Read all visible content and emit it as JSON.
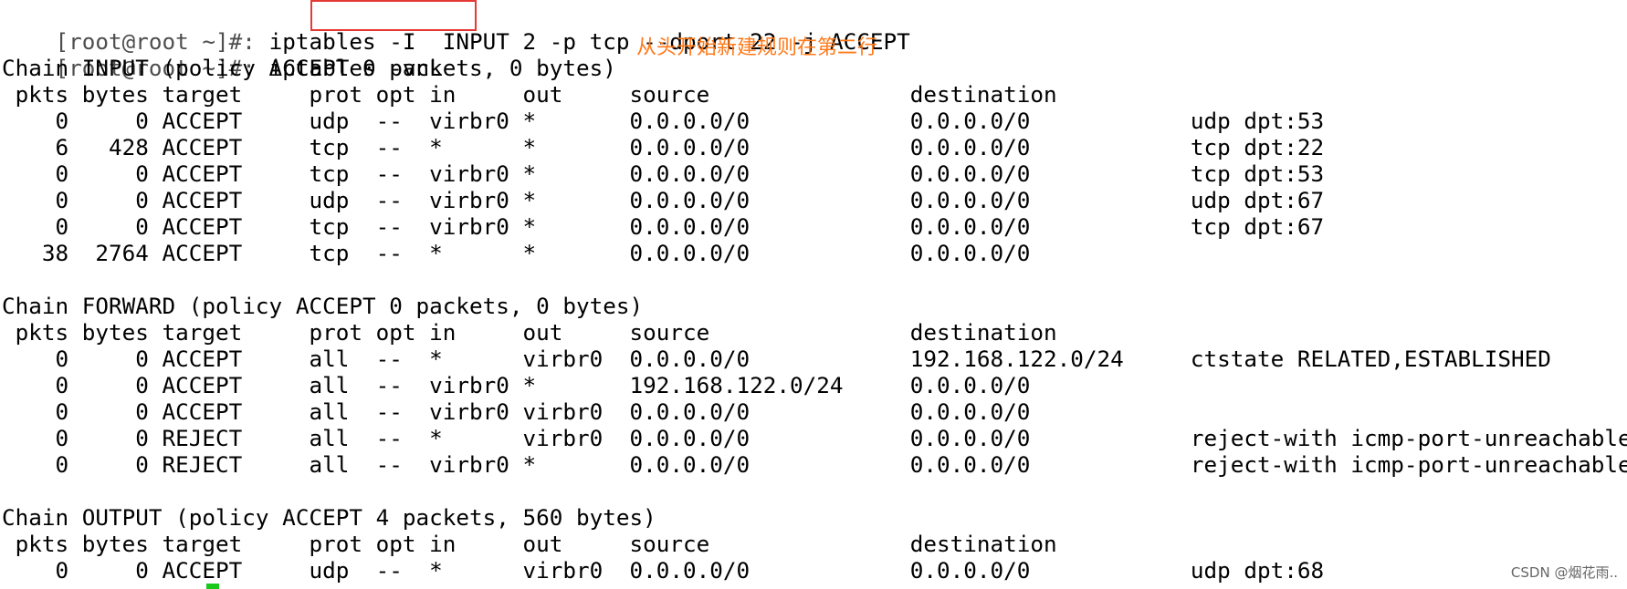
{
  "prompt": "[root@root ~]#: ",
  "commands": [
    "iptables -I  INPUT 2 -p tcp --dport 22 -j ACCEPT",
    "iptables -vnL"
  ],
  "annotation": "从头开始新建规则在第二行",
  "colors": {
    "highlight_box": "#e53935",
    "annotation": "#ff7a1a",
    "cursor": "#19c919",
    "prompt": "#4e4e4e"
  },
  "chains": [
    {
      "header": "Chain INPUT (policy ACCEPT 0 packets, 0 bytes)",
      "rows": [
        {
          "pkts": "0",
          "bytes": "0",
          "target": "ACCEPT",
          "prot": "udp",
          "opt": "--",
          "in": "virbr0",
          "out": "*",
          "source": "0.0.0.0/0",
          "destination": "0.0.0.0/0",
          "extra": "udp dpt:53"
        },
        {
          "pkts": "6",
          "bytes": "428",
          "target": "ACCEPT",
          "prot": "tcp",
          "opt": "--",
          "in": "*",
          "out": "*",
          "source": "0.0.0.0/0",
          "destination": "0.0.0.0/0",
          "extra": "tcp dpt:22"
        },
        {
          "pkts": "0",
          "bytes": "0",
          "target": "ACCEPT",
          "prot": "tcp",
          "opt": "--",
          "in": "virbr0",
          "out": "*",
          "source": "0.0.0.0/0",
          "destination": "0.0.0.0/0",
          "extra": "tcp dpt:53"
        },
        {
          "pkts": "0",
          "bytes": "0",
          "target": "ACCEPT",
          "prot": "udp",
          "opt": "--",
          "in": "virbr0",
          "out": "*",
          "source": "0.0.0.0/0",
          "destination": "0.0.0.0/0",
          "extra": "udp dpt:67"
        },
        {
          "pkts": "0",
          "bytes": "0",
          "target": "ACCEPT",
          "prot": "tcp",
          "opt": "--",
          "in": "virbr0",
          "out": "*",
          "source": "0.0.0.0/0",
          "destination": "0.0.0.0/0",
          "extra": "tcp dpt:67"
        },
        {
          "pkts": "38",
          "bytes": "2764",
          "target": "ACCEPT",
          "prot": "tcp",
          "opt": "--",
          "in": "*",
          "out": "*",
          "source": "0.0.0.0/0",
          "destination": "0.0.0.0/0",
          "extra": ""
        }
      ]
    },
    {
      "header": "Chain FORWARD (policy ACCEPT 0 packets, 0 bytes)",
      "rows": [
        {
          "pkts": "0",
          "bytes": "0",
          "target": "ACCEPT",
          "prot": "all",
          "opt": "--",
          "in": "*",
          "out": "virbr0",
          "source": "0.0.0.0/0",
          "destination": "192.168.122.0/24",
          "extra": "ctstate RELATED,ESTABLISHED"
        },
        {
          "pkts": "0",
          "bytes": "0",
          "target": "ACCEPT",
          "prot": "all",
          "opt": "--",
          "in": "virbr0",
          "out": "*",
          "source": "192.168.122.0/24",
          "destination": "0.0.0.0/0",
          "extra": ""
        },
        {
          "pkts": "0",
          "bytes": "0",
          "target": "ACCEPT",
          "prot": "all",
          "opt": "--",
          "in": "virbr0",
          "out": "virbr0",
          "source": "0.0.0.0/0",
          "destination": "0.0.0.0/0",
          "extra": ""
        },
        {
          "pkts": "0",
          "bytes": "0",
          "target": "REJECT",
          "prot": "all",
          "opt": "--",
          "in": "*",
          "out": "virbr0",
          "source": "0.0.0.0/0",
          "destination": "0.0.0.0/0",
          "extra": "reject-with icmp-port-unreachable"
        },
        {
          "pkts": "0",
          "bytes": "0",
          "target": "REJECT",
          "prot": "all",
          "opt": "--",
          "in": "virbr0",
          "out": "*",
          "source": "0.0.0.0/0",
          "destination": "0.0.0.0/0",
          "extra": "reject-with icmp-port-unreachable"
        }
      ]
    },
    {
      "header": "Chain OUTPUT (policy ACCEPT 4 packets, 560 bytes)",
      "rows": [
        {
          "pkts": "0",
          "bytes": "0",
          "target": "ACCEPT",
          "prot": "udp",
          "opt": "--",
          "in": "*",
          "out": "virbr0",
          "source": "0.0.0.0/0",
          "destination": "0.0.0.0/0",
          "extra": "udp dpt:68"
        }
      ]
    }
  ],
  "column_header": " pkts bytes target     prot opt in     out     source               destination",
  "watermark": "CSDN @烟花雨.."
}
